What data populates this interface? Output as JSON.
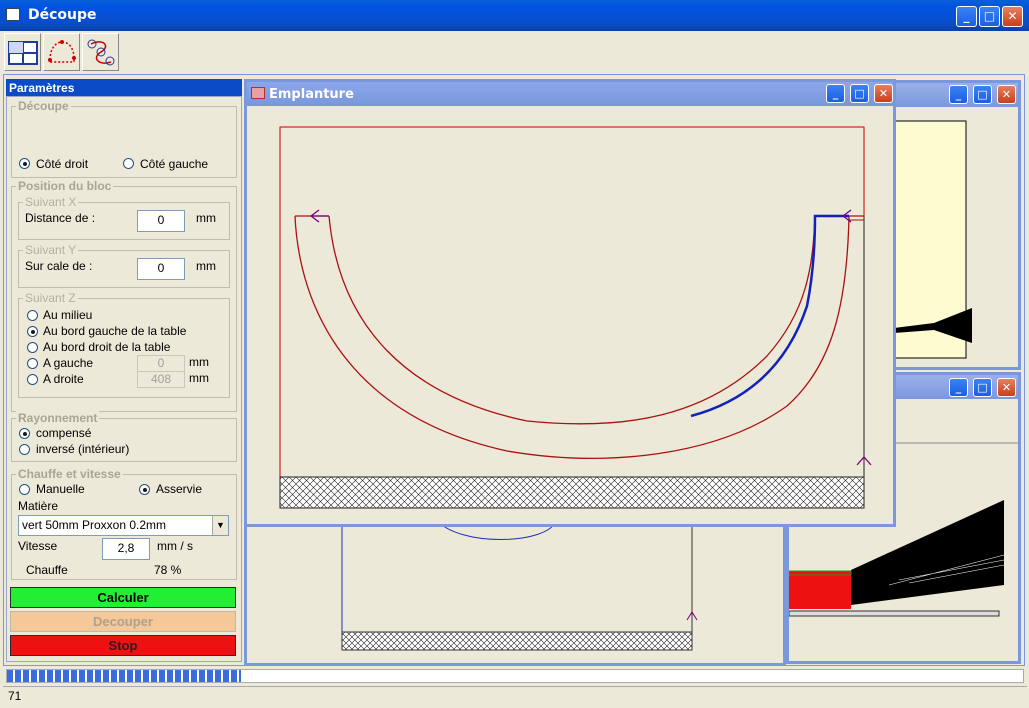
{
  "window": {
    "title": "Découpe",
    "buttons": [
      "_",
      "□",
      "X"
    ]
  },
  "toolbar": {
    "icons": [
      "layout-grid-icon",
      "shape-outline-icon",
      "numbered-path-icon"
    ]
  },
  "params": {
    "title": "Paramètres",
    "decoupe": {
      "legend": "Découpe",
      "opt_right": "Côté droit",
      "opt_left": "Côté gauche",
      "selected": "right"
    },
    "position": {
      "legend": "Position du bloc",
      "x": {
        "legend": "Suivant X",
        "label": "Distance de :",
        "value": "0",
        "unit": "mm"
      },
      "y": {
        "legend": "Suivant Y",
        "label": "Sur cale de :",
        "value": "0",
        "unit": "mm"
      },
      "z": {
        "legend": "Suivant Z",
        "options": [
          "Au milieu",
          "Au bord gauche de la table",
          "Au bord droit de la table",
          "A gauche",
          "A droite"
        ],
        "selected": 1,
        "left_value": "0",
        "right_value": "408",
        "unit": "mm"
      }
    },
    "rayonnement": {
      "legend": "Rayonnement",
      "opt1": "compensé",
      "opt2": "inversé (intérieur)",
      "selected": 1
    },
    "chauffe": {
      "legend": "Chauffe et vitesse",
      "opt_manual": "Manuelle",
      "opt_auto": "Asservie",
      "selected": "auto",
      "matiere_label": "Matière",
      "matiere_value": "vert 50mm Proxxon 0.2mm",
      "vitesse_label": "Vitesse",
      "vitesse_value": "2,8",
      "vitesse_unit": "mm / s",
      "chauffe_label": "Chauffe",
      "chauffe_value": "78 %"
    },
    "buttons": {
      "calculer": "Calculer",
      "decouper": "Decouper",
      "stop": "Stop"
    }
  },
  "emplanture": {
    "title": "Emplanture"
  },
  "status": {
    "progress": 0.23,
    "value": "71"
  },
  "colors": {
    "calculer": "#22ee33",
    "decouper": "#f5c89a",
    "stop": "#ee1111",
    "titlebar": "#0054e3"
  }
}
